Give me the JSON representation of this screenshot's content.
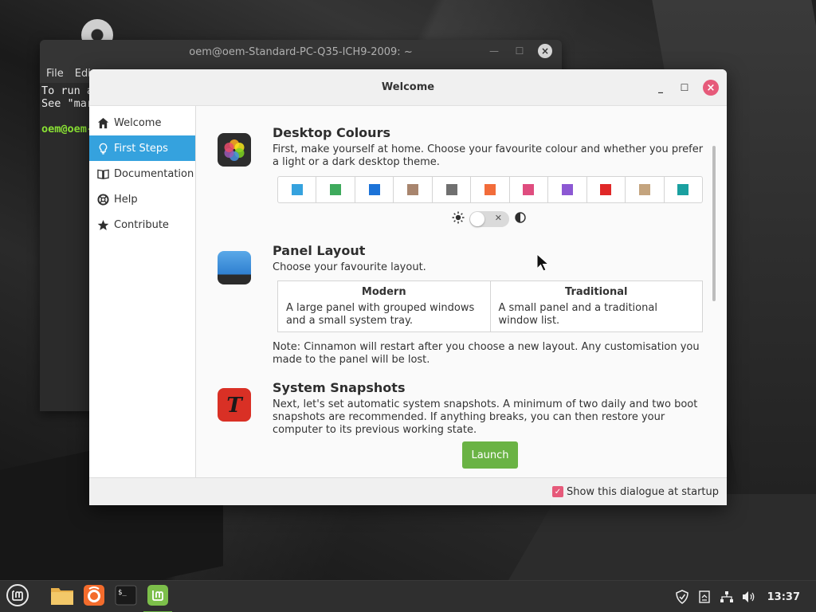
{
  "terminal": {
    "title": "oem@oem-Standard-PC-Q35-ICH9-2009: ~",
    "menu": [
      "File",
      "Edi"
    ],
    "lines": [
      "To run a",
      "See \"mar"
    ],
    "prompt": "oem@oem-"
  },
  "welcome": {
    "title": "Welcome",
    "sidebar": {
      "items": [
        {
          "label": "Welcome",
          "icon": "home-icon"
        },
        {
          "label": "First Steps",
          "icon": "lightbulb-icon",
          "active": true
        },
        {
          "label": "Documentation",
          "icon": "book-icon"
        },
        {
          "label": "Help",
          "icon": "lifebuoy-icon"
        },
        {
          "label": "Contribute",
          "icon": "star-icon"
        }
      ]
    },
    "colours": {
      "title": "Desktop Colours",
      "text": "First, make yourself at home. Choose your favourite colour and whether you prefer a light or a dark desktop theme.",
      "swatches": [
        "#35a2de",
        "#3eaa5c",
        "#1c73d8",
        "#a8856e",
        "#707070",
        "#f26c3a",
        "#df4d7f",
        "#8c58d3",
        "#e02828",
        "#c4a47e",
        "#1aa0a0"
      ],
      "theme_dark": false
    },
    "panel": {
      "title": "Panel Layout",
      "text": "Choose your favourite layout.",
      "options": [
        {
          "name": "Modern",
          "desc": "A large panel with grouped windows and a small system tray."
        },
        {
          "name": "Traditional",
          "desc": "A small panel and a traditional window list."
        }
      ],
      "note": "Note: Cinnamon will restart after you choose a new layout. Any customisation you made to the panel will be lost."
    },
    "snapshots": {
      "title": "System Snapshots",
      "text": "Next, let's set automatic system snapshots. A minimum of two daily and two boot snapshots are recommended. If anything breaks, you can then restore your computer to its previous working state.",
      "button": "Launch"
    },
    "footer": {
      "checkbox_label": "Show this dialogue at startup",
      "checked": true
    }
  },
  "taskbar": {
    "apps": [
      "menu-icon",
      "files-icon",
      "firefox-icon",
      "terminal-icon",
      "welcome-icon"
    ],
    "clock": "13:37",
    "accent": "#6ab344"
  }
}
